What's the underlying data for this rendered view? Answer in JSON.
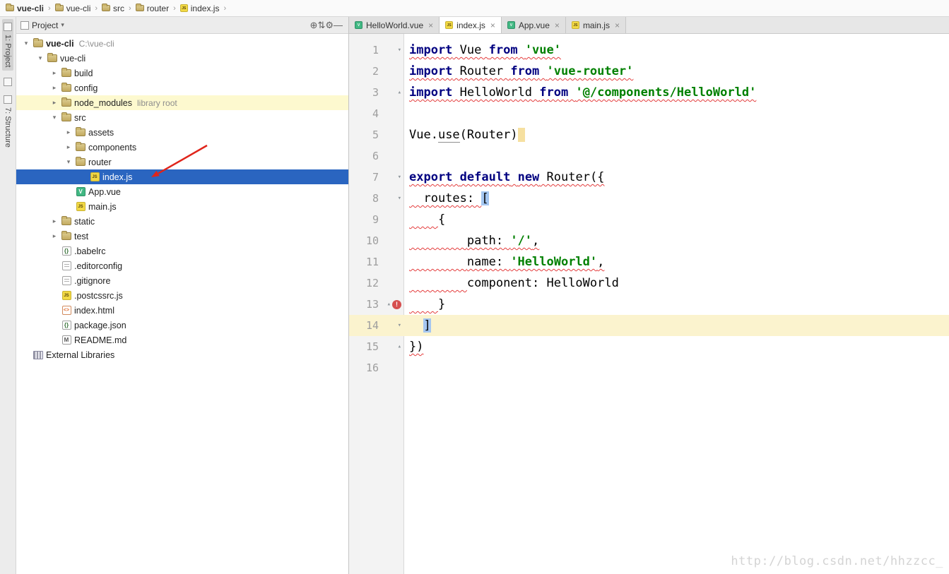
{
  "breadcrumb": {
    "separator": "›",
    "items": [
      {
        "label": "vue-cli",
        "icon": "folder",
        "bold": true
      },
      {
        "label": "vue-cli",
        "icon": "folder"
      },
      {
        "label": "src",
        "icon": "folder"
      },
      {
        "label": "router",
        "icon": "folder"
      },
      {
        "label": "index.js",
        "icon": "js"
      }
    ]
  },
  "left_stripe": {
    "project_label": "1: Project",
    "structure_label": "7: Structure"
  },
  "project_panel": {
    "title": "Project",
    "title_caret": "▾",
    "toolbar_icons": [
      {
        "name": "locate-icon",
        "glyph": "⊕"
      },
      {
        "name": "collapse-all-icon",
        "glyph": "⇅"
      },
      {
        "name": "settings-gear-icon",
        "glyph": "⚙"
      },
      {
        "name": "hide-panel-icon",
        "glyph": "―"
      }
    ],
    "tree": [
      {
        "label": "vue-cli",
        "suffix": "C:\\vue-cli",
        "icon": "folder",
        "level": 0,
        "chevron": "expanded",
        "bold": true
      },
      {
        "label": "vue-cli",
        "icon": "folder",
        "level": 1,
        "chevron": "expanded"
      },
      {
        "label": "build",
        "icon": "folder",
        "level": 2,
        "chevron": "collapsed"
      },
      {
        "label": "config",
        "icon": "folder",
        "level": 2,
        "chevron": "collapsed"
      },
      {
        "label": "node_modules",
        "suffix": "library root",
        "icon": "folder",
        "level": 2,
        "chevron": "collapsed",
        "highlight": "yellow"
      },
      {
        "label": "src",
        "icon": "folder",
        "level": 2,
        "chevron": "expanded"
      },
      {
        "label": "assets",
        "icon": "folder",
        "level": 3,
        "chevron": "collapsed"
      },
      {
        "label": "components",
        "icon": "folder",
        "level": 3,
        "chevron": "collapsed"
      },
      {
        "label": "router",
        "icon": "folder",
        "level": 3,
        "chevron": "expanded"
      },
      {
        "label": "index.js",
        "icon": "js",
        "level": 4,
        "selected": true
      },
      {
        "label": "App.vue",
        "icon": "vue",
        "level": 3
      },
      {
        "label": "main.js",
        "icon": "js",
        "level": 3
      },
      {
        "label": "static",
        "icon": "folder",
        "level": 2,
        "chevron": "collapsed"
      },
      {
        "label": "test",
        "icon": "folder",
        "level": 2,
        "chevron": "collapsed"
      },
      {
        "label": ".babelrc",
        "icon": "json",
        "level": 2
      },
      {
        "label": ".editorconfig",
        "icon": "config",
        "level": 2
      },
      {
        "label": ".gitignore",
        "icon": "config",
        "level": 2
      },
      {
        "label": ".postcssrc.js",
        "icon": "js",
        "level": 2
      },
      {
        "label": "index.html",
        "icon": "html",
        "level": 2
      },
      {
        "label": "package.json",
        "icon": "json",
        "level": 2
      },
      {
        "label": "README.md",
        "icon": "md",
        "level": 2
      },
      {
        "label": "External Libraries",
        "icon": "lib",
        "level": 0
      }
    ]
  },
  "editor": {
    "close_glyph": "×",
    "tabs": [
      {
        "label": "HelloWorld.vue",
        "icon": "vue",
        "active": false
      },
      {
        "label": "index.js",
        "icon": "js",
        "active": true
      },
      {
        "label": "App.vue",
        "icon": "vue",
        "active": false
      },
      {
        "label": "main.js",
        "icon": "js",
        "active": false
      }
    ],
    "lines": [
      {
        "n": 1,
        "fold": "down",
        "tokens": [
          {
            "t": "kw",
            "x": "import",
            "w": 1
          },
          {
            "t": "p",
            "x": " Vue ",
            "w": 1
          },
          {
            "t": "kw",
            "x": "from",
            "w": 1
          },
          {
            "t": "p",
            "x": " ",
            "w": 1
          },
          {
            "t": "s",
            "x": "'vue'",
            "w": 1
          }
        ]
      },
      {
        "n": 2,
        "tokens": [
          {
            "t": "kw",
            "x": "import",
            "w": 1
          },
          {
            "t": "p",
            "x": " Router ",
            "w": 1
          },
          {
            "t": "kw",
            "x": "from",
            "w": 1
          },
          {
            "t": "p",
            "x": " ",
            "w": 1
          },
          {
            "t": "s",
            "x": "'vue-router'",
            "w": 1
          }
        ]
      },
      {
        "n": 3,
        "fold": "up",
        "tokens": [
          {
            "t": "kw",
            "x": "import",
            "w": 1
          },
          {
            "t": "p",
            "x": " HelloWorld ",
            "w": 1
          },
          {
            "t": "kw",
            "x": "from",
            "w": 1
          },
          {
            "t": "p",
            "x": " ",
            "w": 1
          },
          {
            "t": "s",
            "x": "'@/components/HelloWorld'",
            "w": 1
          }
        ]
      },
      {
        "n": 4,
        "tokens": []
      },
      {
        "n": 5,
        "tokens": [
          {
            "t": "p",
            "x": "Vue."
          },
          {
            "t": "pu",
            "x": "use"
          },
          {
            "t": "p",
            "x": "(Router)"
          },
          {
            "t": "hl",
            "x": " "
          }
        ]
      },
      {
        "n": 6,
        "tokens": []
      },
      {
        "n": 7,
        "fold": "down",
        "tokens": [
          {
            "t": "kw",
            "x": "export",
            "w": 1
          },
          {
            "t": "p",
            "x": " ",
            "w": 1
          },
          {
            "t": "kw",
            "x": "default",
            "w": 1
          },
          {
            "t": "p",
            "x": " ",
            "w": 1
          },
          {
            "t": "kw",
            "x": "new",
            "w": 1
          },
          {
            "t": "p",
            "x": " Router({",
            "w": 1
          }
        ]
      },
      {
        "n": 8,
        "fold": "down",
        "tokens": [
          {
            "t": "p",
            "x": "  routes: ",
            "w": 1
          },
          {
            "t": "b",
            "x": "["
          }
        ]
      },
      {
        "n": 9,
        "tokens": [
          {
            "t": "p",
            "x": "    ",
            "w": 1
          },
          {
            "t": "p",
            "x": "{"
          }
        ]
      },
      {
        "n": 10,
        "tokens": [
          {
            "t": "p",
            "x": "        ",
            "w": 1
          },
          {
            "t": "p",
            "x": "path: ",
            "w": 1
          },
          {
            "t": "s",
            "x": "'/'",
            "w": 1
          },
          {
            "t": "p",
            "x": ",",
            "w": 1
          }
        ]
      },
      {
        "n": 11,
        "tokens": [
          {
            "t": "p",
            "x": "        ",
            "w": 1
          },
          {
            "t": "p",
            "x": "name: ",
            "w": 1
          },
          {
            "t": "s",
            "x": "'HelloWorld'",
            "w": 1
          },
          {
            "t": "p",
            "x": ",",
            "w": 1
          }
        ]
      },
      {
        "n": 12,
        "tokens": [
          {
            "t": "p",
            "x": "        ",
            "w": 1
          },
          {
            "t": "p",
            "x": "component: HelloWorld"
          }
        ]
      },
      {
        "n": 13,
        "fold": "up",
        "error": true,
        "tokens": [
          {
            "t": "p",
            "x": "    ",
            "w": 1
          },
          {
            "t": "p",
            "x": "}"
          }
        ]
      },
      {
        "n": 14,
        "fold": "down",
        "caret": true,
        "tokens": [
          {
            "t": "p",
            "x": "  "
          },
          {
            "t": "b",
            "x": "]"
          }
        ]
      },
      {
        "n": 15,
        "fold": "up",
        "tokens": [
          {
            "t": "p",
            "x": "})",
            "w": 1
          }
        ]
      },
      {
        "n": 16,
        "tokens": []
      }
    ]
  },
  "icons": {
    "chevron_expanded": "▾",
    "chevron_collapsed": "▸",
    "fold_down": "▾",
    "fold_up": "▴",
    "error_glyph": "!"
  },
  "colors": {
    "selection": "#2a65c0",
    "caret_line": "#fbf3ce",
    "keyword": "#000080",
    "string": "#008000",
    "error": "#d64f4f",
    "annotation_arrow": "#e0251b"
  },
  "watermark": "http://blog.csdn.net/hhzzcc_"
}
